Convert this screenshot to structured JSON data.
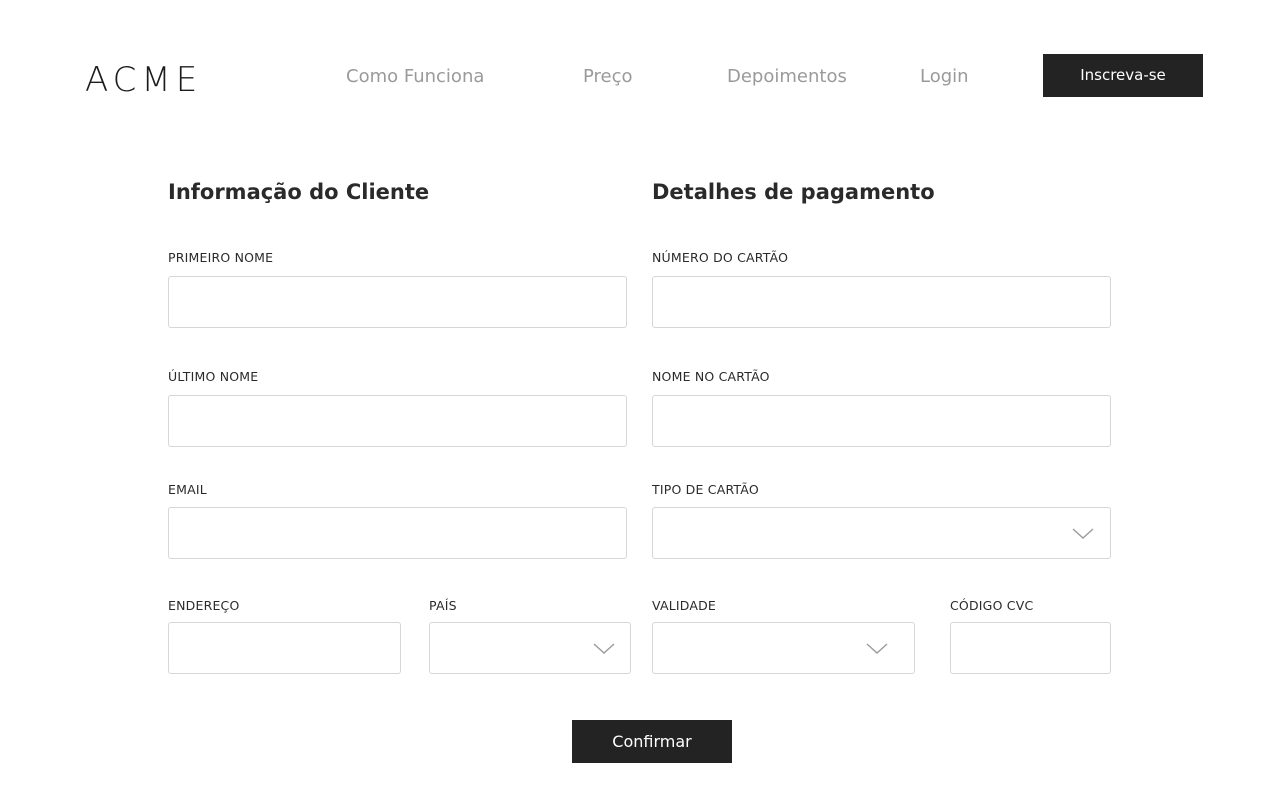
{
  "header": {
    "logo": "ACME",
    "nav": [
      {
        "label": "Como Funciona"
      },
      {
        "label": "Preço"
      },
      {
        "label": "Depoimentos"
      },
      {
        "label": "Login"
      }
    ],
    "signup_label": "Inscreva-se"
  },
  "customer": {
    "title": "Informação do Cliente",
    "first_name": {
      "label": "PRIMEIRO NOME",
      "value": ""
    },
    "last_name": {
      "label": "ÚLTIMO NOME",
      "value": ""
    },
    "email": {
      "label": "EMAIL",
      "value": ""
    },
    "address": {
      "label": "ENDEREÇO",
      "value": ""
    },
    "country": {
      "label": "PAÍS",
      "selected": ""
    }
  },
  "payment": {
    "title": "Detalhes de pagamento",
    "card_number": {
      "label": "NÚMERO DO CARTÃO",
      "value": ""
    },
    "card_name": {
      "label": "NOME NO CARTÃO",
      "value": ""
    },
    "card_type": {
      "label": "TIPO DE CARTÃO",
      "selected": ""
    },
    "expiry": {
      "label": "VALIDADE",
      "selected": ""
    },
    "cvc": {
      "label": "CÓDIGO CVC",
      "value": ""
    }
  },
  "confirm_label": "Confirmar",
  "colors": {
    "button_bg": "#232323",
    "nav_text": "#9a9a9a",
    "input_border": "#d6d6d6"
  },
  "icons": [
    "chevron-down-icon"
  ]
}
